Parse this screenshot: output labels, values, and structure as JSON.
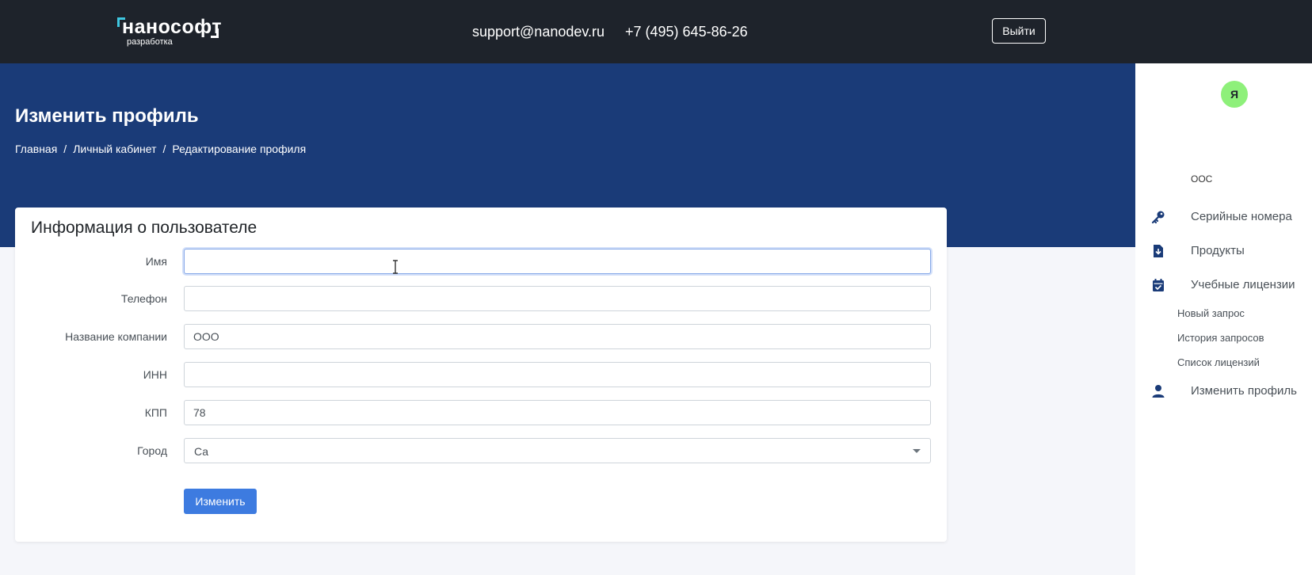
{
  "header": {
    "logo_text": "нанософт",
    "logo_sub": "разработка",
    "email": "support@nanodev.ru",
    "phone": "+7 (495) 645-86-26",
    "logout_label": "Выйти"
  },
  "hero": {
    "title": "Изменить профиль",
    "breadcrumb": [
      "Главная",
      "Личный кабинет",
      "Редактирование профиля"
    ]
  },
  "form": {
    "title": "Информация о пользователе",
    "fields": [
      {
        "label": "Имя",
        "value": ""
      },
      {
        "label": "Телефон",
        "value": ""
      },
      {
        "label": "Название компании",
        "value": "ООО"
      },
      {
        "label": "ИНН",
        "value": ""
      },
      {
        "label": "КПП",
        "value": "78"
      },
      {
        "label": "Город",
        "value": "Са"
      }
    ],
    "submit_label": "Изменить"
  },
  "sidebar": {
    "avatar_letter": "Я",
    "company": "ООС",
    "nav": [
      {
        "label": "Серийные номера",
        "icon": "key-icon"
      },
      {
        "label": "Продукты",
        "icon": "download-file-icon"
      },
      {
        "label": "Учебные лицензии",
        "icon": "calendar-check-icon"
      },
      {
        "label": "Изменить профиль",
        "icon": "user-icon"
      }
    ],
    "subnav": [
      "Новый запрос",
      "История запросов",
      "Список лицензий"
    ]
  },
  "colors": {
    "topbar": "#1e232b",
    "hero": "#1a3b78",
    "accent_button": "#3d7be0",
    "avatar": "#8ef07a",
    "nav_icon": "#1a3b78"
  }
}
